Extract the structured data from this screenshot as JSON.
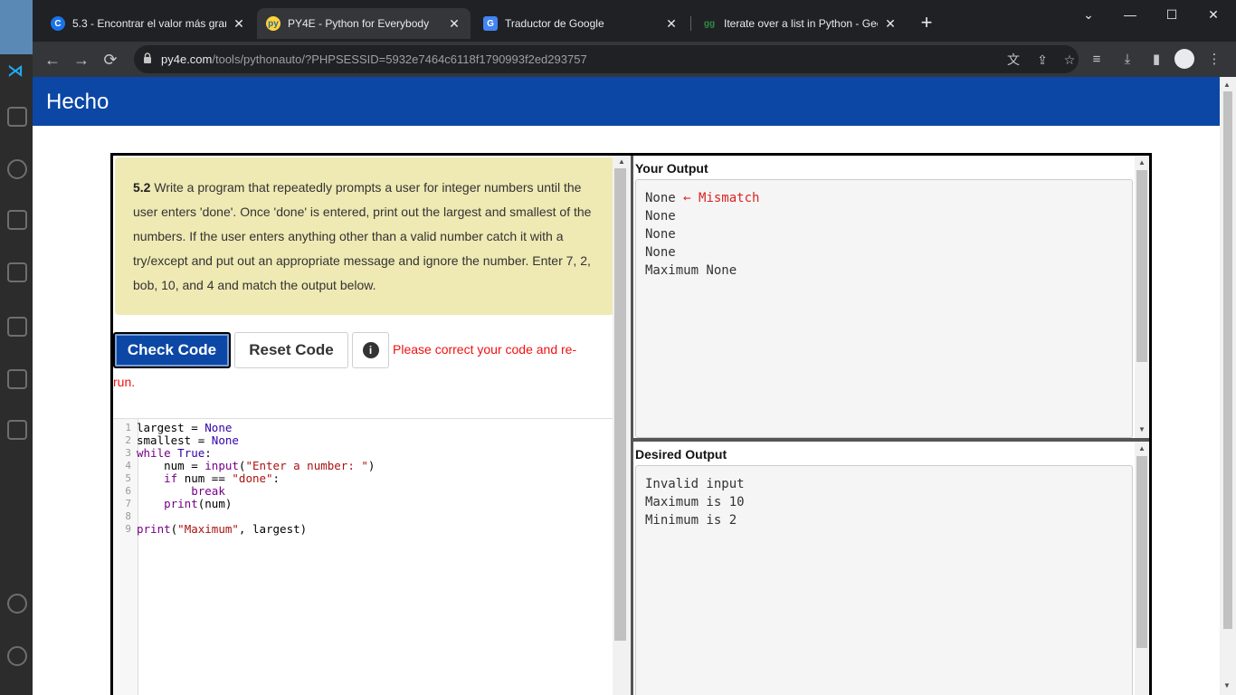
{
  "tabs": [
    {
      "title": "5.3 - Encontrar el valor más gran",
      "favicon": "C",
      "active": false
    },
    {
      "title": "PY4E - Python for Everybody",
      "favicon": "py",
      "active": true
    },
    {
      "title": "Traductor de Google",
      "favicon": "G",
      "active": false
    },
    {
      "title": "Iterate over a list in Python - Gee",
      "favicon": "gg",
      "active": false
    }
  ],
  "tab_close_glyph": "✕",
  "newtab_glyph": "+",
  "window_controls": {
    "chevron": "⌄",
    "minimize": "—",
    "maximize": "☐",
    "close": "✕"
  },
  "toolbar": {
    "back": "←",
    "forward": "→",
    "reload": "⟳",
    "url_host": "py4e.com",
    "url_path": "/tools/pythonauto/?PHPSESSID=5932e7464c6118f1790993f2ed293757"
  },
  "icons": {
    "translate": "translate-icon",
    "share": "share-icon",
    "star": "star-icon",
    "reading_list": "reading-list-icon",
    "download": "download-icon",
    "side_panel": "side-panel-icon",
    "profile": "profile-icon",
    "menu": "menu-icon"
  },
  "banner": {
    "brand": "Hecho",
    "color": "#0c47a6"
  },
  "instructions": {
    "number": "5.2",
    "text": " Write a program that repeatedly prompts a user for integer numbers until the user enters 'done'. Once 'done' is entered, print out the largest and smallest of the numbers. If the user enters anything other than a valid number catch it with a try/except and put out an appropriate message and ignore the number. Enter 7, 2, bob, 10, and 4 and match the output below."
  },
  "buttons": {
    "check": "Check Code",
    "reset": "Reset Code",
    "info": "i"
  },
  "error": {
    "line1": "Please correct your code and re-",
    "line2": "run."
  },
  "code": {
    "line_numbers": [
      "1",
      "2",
      "3",
      "4",
      "5",
      "6",
      "7",
      "8",
      "9"
    ]
  },
  "your_output": {
    "title": "Your Output",
    "first_line": "None",
    "mismatch": "← Mismatch",
    "lines": [
      "None",
      "None",
      "None",
      "Maximum None"
    ]
  },
  "desired_output": {
    "title": "Desired Output",
    "lines": [
      "Invalid input",
      "Maximum is 10",
      "Minimum is 2"
    ]
  }
}
